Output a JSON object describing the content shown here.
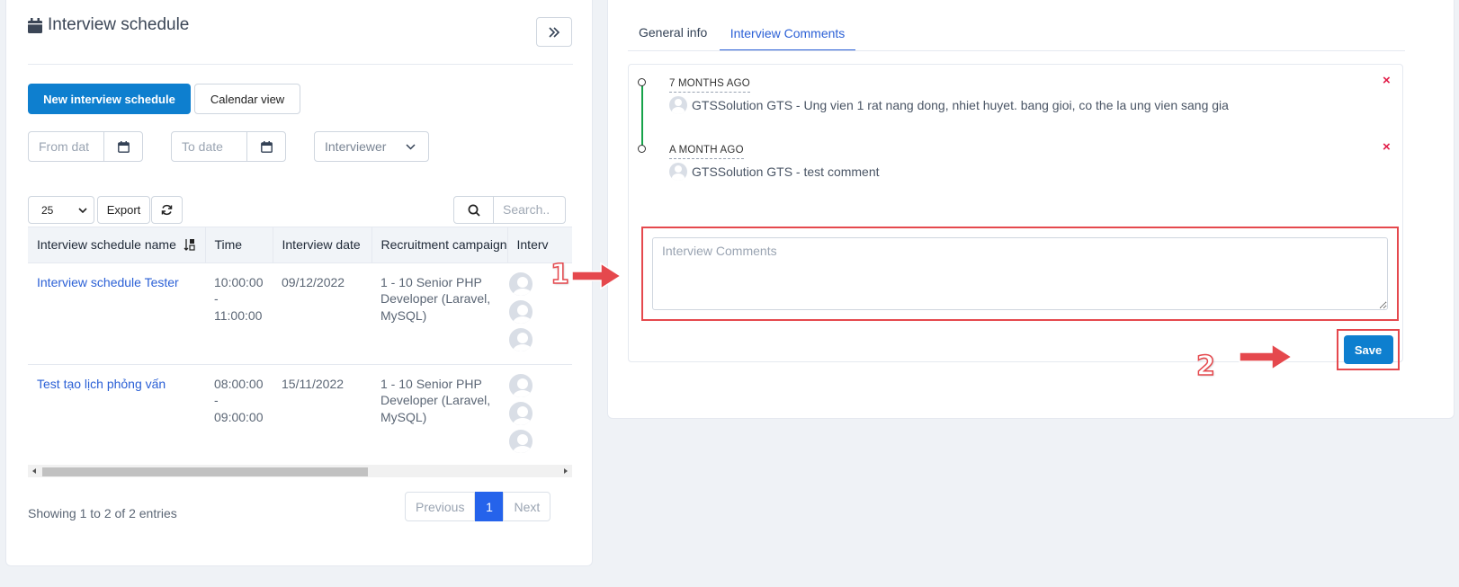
{
  "left": {
    "title": "Interview schedule",
    "collapse_icon": "double-chevron-right",
    "new_button": "New interview schedule",
    "calendar_button": "Calendar view",
    "from_date_placeholder": "From dat",
    "to_date_placeholder": "To date",
    "interviewer_label": "Interviewer",
    "page_length": "25",
    "export_label": "Export",
    "search_placeholder": "Search..",
    "table": {
      "headers": [
        "Interview schedule name",
        "Time",
        "Interview date",
        "Recruitment campaign",
        "Interv"
      ],
      "rows": [
        {
          "name": "Interview schedule Tester",
          "time_start": "10:00:00",
          "time_sep": "-",
          "time_end": "11:00:00",
          "date": "09/12/2022",
          "campaign": "1 - 10 Senior PHP Developer (Laravel, MySQL)"
        },
        {
          "name": "Test tạo lịch phỏng vấn",
          "time_start": "08:00:00",
          "time_sep": "-",
          "time_end": "09:00:00",
          "date": "15/11/2022",
          "campaign": "1 - 10 Senior PHP Developer (Laravel, MySQL)"
        }
      ]
    },
    "showing_text": "Showing 1 to 2 of 2 entries",
    "pager": {
      "previous": "Previous",
      "current": "1",
      "next": "Next"
    }
  },
  "right": {
    "tabs": {
      "general": "General info",
      "comments": "Interview Comments"
    },
    "comments": [
      {
        "time": "7 MONTHS AGO",
        "text": "GTSSolution GTS - Ung vien 1 rat nang dong, nhiet huyet. bang gioi, co the la ung vien sang gia"
      },
      {
        "time": "A MONTH AGO",
        "text": "GTSSolution GTS - test comment"
      }
    ],
    "delete_symbol": "×",
    "comment_placeholder": "Interview Comments",
    "save_label": "Save"
  },
  "annotations": {
    "step1": "1",
    "step2": "2",
    "color": "#e5484d"
  },
  "colors": {
    "primary": "#0e7fcf",
    "link": "#2b60d6",
    "timeline": "#16a34a",
    "active_page": "#2563eb"
  }
}
